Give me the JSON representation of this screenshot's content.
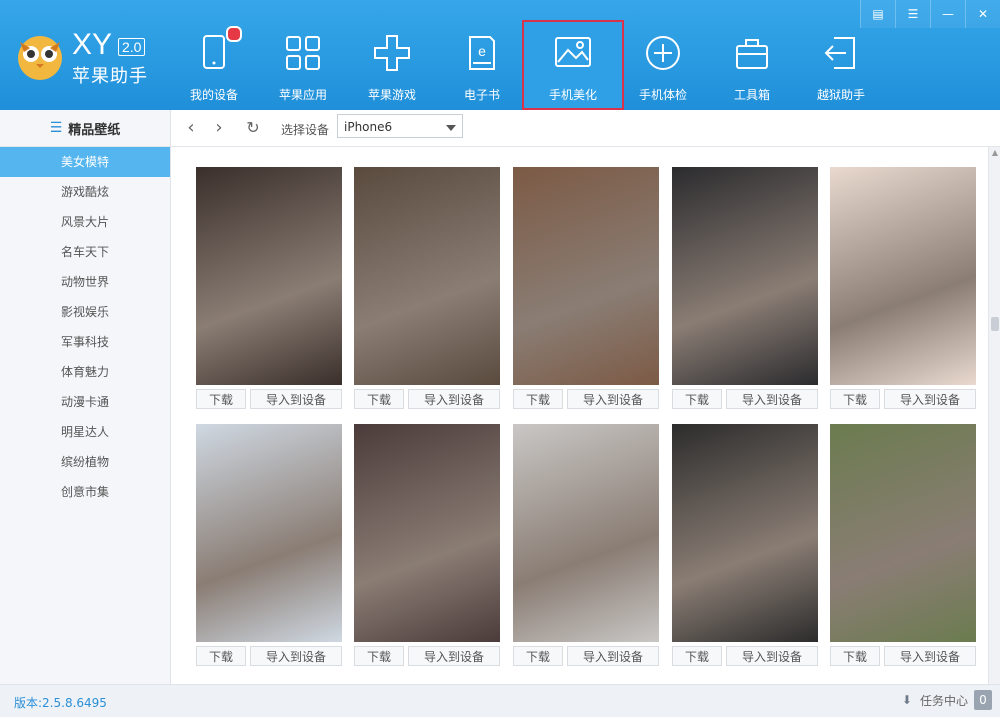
{
  "app": {
    "logo_text": "XY",
    "version_badge": "2.0",
    "name": "苹果助手"
  },
  "window_controls": [
    {
      "icon": "menu-icon"
    },
    {
      "icon": "settings-menu-icon"
    },
    {
      "icon": "minimize-icon"
    },
    {
      "icon": "close-icon"
    }
  ],
  "nav": [
    {
      "label": "我的设备",
      "icon": "tablet-icon",
      "badge": true
    },
    {
      "label": "苹果应用",
      "icon": "grid-icon"
    },
    {
      "label": "苹果游戏",
      "icon": "gamepad-icon"
    },
    {
      "label": "电子书",
      "icon": "ebook-icon"
    },
    {
      "label": "手机美化",
      "icon": "image-icon",
      "active": true
    },
    {
      "label": "手机体检",
      "icon": "plus-circle-icon"
    },
    {
      "label": "工具箱",
      "icon": "toolbox-icon"
    },
    {
      "label": "越狱助手",
      "icon": "exit-icon"
    }
  ],
  "sidebar": {
    "title": "精品壁纸",
    "items": [
      {
        "label": "美女模特",
        "active": true
      },
      {
        "label": "游戏酷炫"
      },
      {
        "label": "风景大片"
      },
      {
        "label": "名车天下"
      },
      {
        "label": "动物世界"
      },
      {
        "label": "影视娱乐"
      },
      {
        "label": "军事科技"
      },
      {
        "label": "体育魅力"
      },
      {
        "label": "动漫卡通"
      },
      {
        "label": "明星达人"
      },
      {
        "label": "缤纷植物"
      },
      {
        "label": "创意市集"
      }
    ]
  },
  "toolbar": {
    "select_label": "选择设备",
    "device": "iPhone6"
  },
  "cards": {
    "download_label": "下载",
    "import_label": "导入到设备",
    "colors": [
      "#3b2f2b",
      "#5a4a3e",
      "#7c5a45",
      "#2b2b2e",
      "#e9d9cf",
      "#cfd8e2",
      "#4b3b3a",
      "#c9c7c5",
      "#2c2c2c",
      "#6b7c4f"
    ]
  },
  "status": {
    "version": "版本:2.5.8.6495",
    "task_center": "任务中心",
    "task_count": "0"
  }
}
